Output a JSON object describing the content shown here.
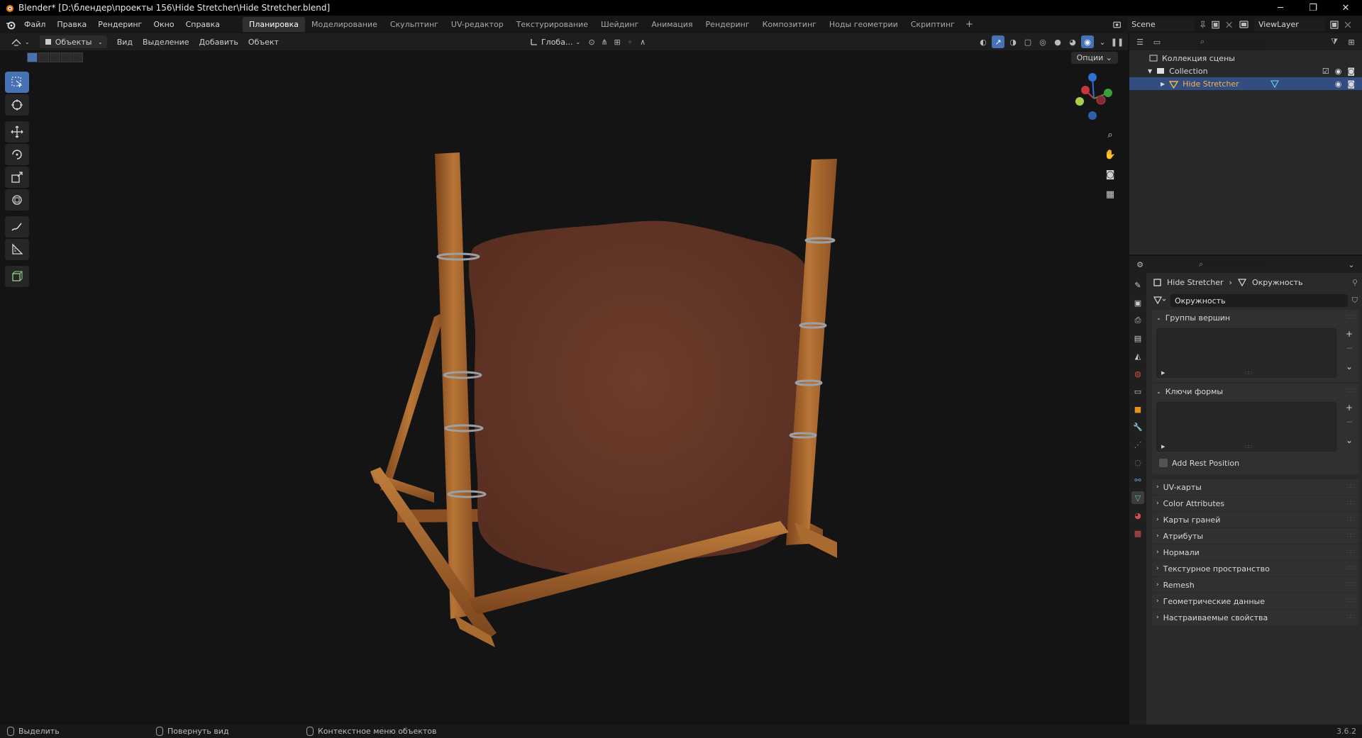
{
  "window": {
    "title": "Blender* [D:\\блендер\\проекты 156\\Hide Stretcher\\Hide Stretcher.blend]",
    "minimize": "─",
    "maximize": "❐",
    "close": "✕"
  },
  "menu": {
    "items": [
      "Файл",
      "Правка",
      "Рендеринг",
      "Окно",
      "Справка"
    ]
  },
  "workspaces": {
    "tabs": [
      "Планировка",
      "Моделирование",
      "Скульптинг",
      "UV-редактор",
      "Текстурирование",
      "Шейдинг",
      "Анимация",
      "Рендеринг",
      "Композитинг",
      "Ноды геометрии",
      "Скриптинг"
    ],
    "active_index": 0,
    "add": "+"
  },
  "scene": {
    "name": "Scene"
  },
  "view_layer": {
    "name": "ViewLayer"
  },
  "viewport_header": {
    "mode": "Объекты",
    "menus": [
      "Вид",
      "Выделение",
      "Добавить",
      "Объект"
    ],
    "transform_orientation": "Глоба...",
    "options": "Опции"
  },
  "outliner": {
    "scene_collection": "Коллекция сцены",
    "collection": "Collection",
    "object": "Hide Stretcher"
  },
  "properties": {
    "object_name": "Hide Stretcher",
    "mesh_name": "Окружность",
    "datablock_name": "Окружность",
    "panels": {
      "vertex_groups": "Группы вершин",
      "shape_keys": "Ключи формы",
      "add_rest_position": "Add Rest Position"
    },
    "collapsed_panels": [
      "UV-карты",
      "Color Attributes",
      "Карты граней",
      "Атрибуты",
      "Нормали",
      "Текстурное пространство",
      "Remesh",
      "Геометрические данные",
      "Настраиваемые свойства"
    ]
  },
  "statusbar": {
    "select": "Выделить",
    "rotate_view": "Повернуть вид",
    "context_menu": "Контекстное меню объектов",
    "version": "3.6.2"
  },
  "colors": {
    "accent": "#4772b3",
    "wood": "#a0622e",
    "hide": "#6b3a2a",
    "selected_object_text": "#f2b54a"
  }
}
